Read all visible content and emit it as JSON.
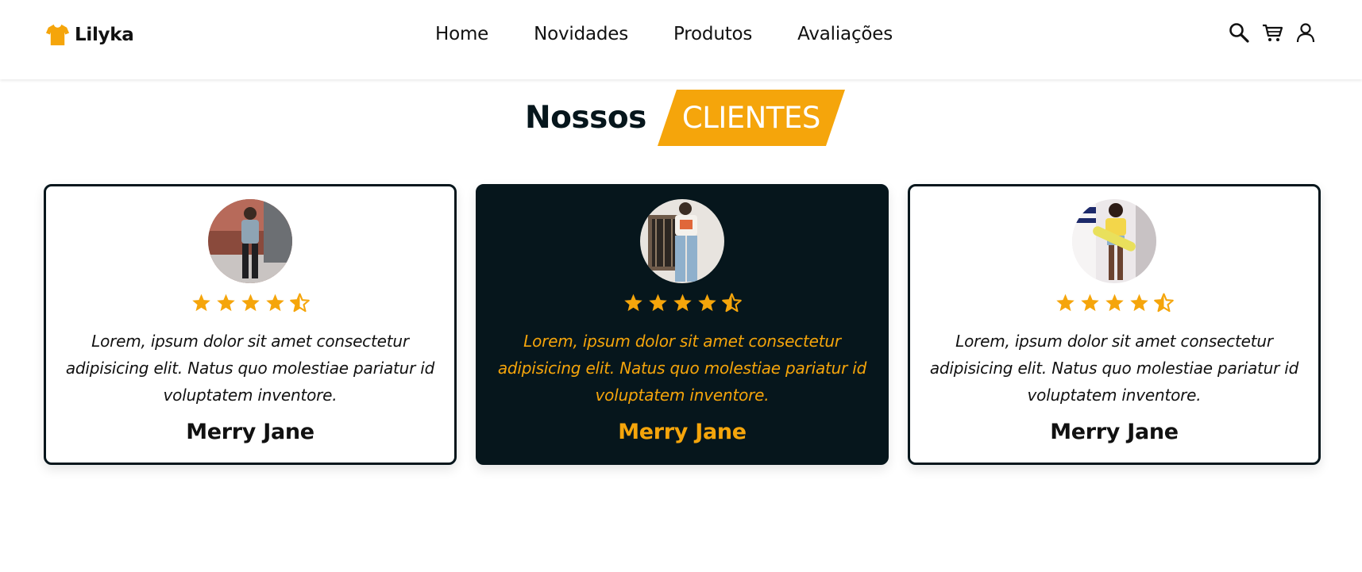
{
  "header": {
    "brand": "Lilyka",
    "nav": [
      {
        "label": "Home"
      },
      {
        "label": "Novidades"
      },
      {
        "label": "Produtos"
      },
      {
        "label": "Avaliações"
      }
    ],
    "icons": [
      "search-icon",
      "cart-icon",
      "user-icon"
    ]
  },
  "section": {
    "title_plain": "Nossos",
    "title_highlight": "CLIENTES"
  },
  "colors": {
    "accent": "#f5a50b",
    "dark": "#06161c",
    "background": "#ffffff"
  },
  "testimonials": [
    {
      "rating": 4.5,
      "quote": "Lorem, ipsum dolor sit amet consectetur adipisicing elit. Natus quo molestiae pariatur id voluptatem inventore.",
      "name": "Merry Jane",
      "theme": "light"
    },
    {
      "rating": 4.5,
      "quote": "Lorem, ipsum dolor sit amet consectetur adipisicing elit. Natus quo molestiae pariatur id voluptatem inventore.",
      "name": "Merry Jane",
      "theme": "dark"
    },
    {
      "rating": 4.5,
      "quote": "Lorem, ipsum dolor sit amet consectetur adipisicing elit. Natus quo molestiae pariatur id voluptatem inventore.",
      "name": "Merry Jane",
      "theme": "light"
    }
  ]
}
